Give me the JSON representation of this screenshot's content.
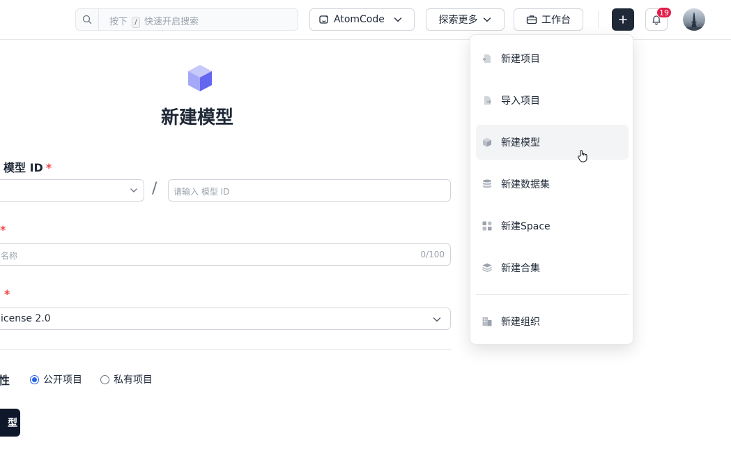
{
  "header": {
    "search": {
      "placeholder_before": "按下",
      "kbd": "/",
      "placeholder_after": "快速开启搜索"
    },
    "atomcode_label": "AtomCode",
    "explore_label": "探索更多",
    "workspace_label": "工作台",
    "notification_count": "19"
  },
  "form": {
    "title": "新建模型",
    "model_id_label": "模型 ID",
    "required_mark": "*",
    "slash": "/",
    "model_id_placeholder": "请输入 模型 ID",
    "name_placeholder": "名称",
    "name_counter": "0/100",
    "license_value": "icense 2.0",
    "visibility_label": "性",
    "visibility_options": [
      "公开项目",
      "私有项目"
    ],
    "visibility_selected": "公开项目",
    "submit_label": "型"
  },
  "menu": {
    "items": [
      {
        "label": "新建项目",
        "icon": "file-plus-icon"
      },
      {
        "label": "导入项目",
        "icon": "file-import-icon"
      },
      {
        "label": "新建模型",
        "icon": "cube-icon"
      },
      {
        "label": "新建数据集",
        "icon": "database-icon"
      },
      {
        "label": "新建Space",
        "icon": "grid-icon"
      },
      {
        "label": "新建合集",
        "icon": "layers-icon"
      },
      {
        "label": "新建组织",
        "icon": "building-icon"
      }
    ],
    "hovered": "新建模型"
  },
  "colors": {
    "primary_dark": "#1f2937",
    "required_red": "#ef4444",
    "badge_red": "#e11d48",
    "radio_blue": "#2563eb",
    "cube_purple": "#6366f1"
  }
}
